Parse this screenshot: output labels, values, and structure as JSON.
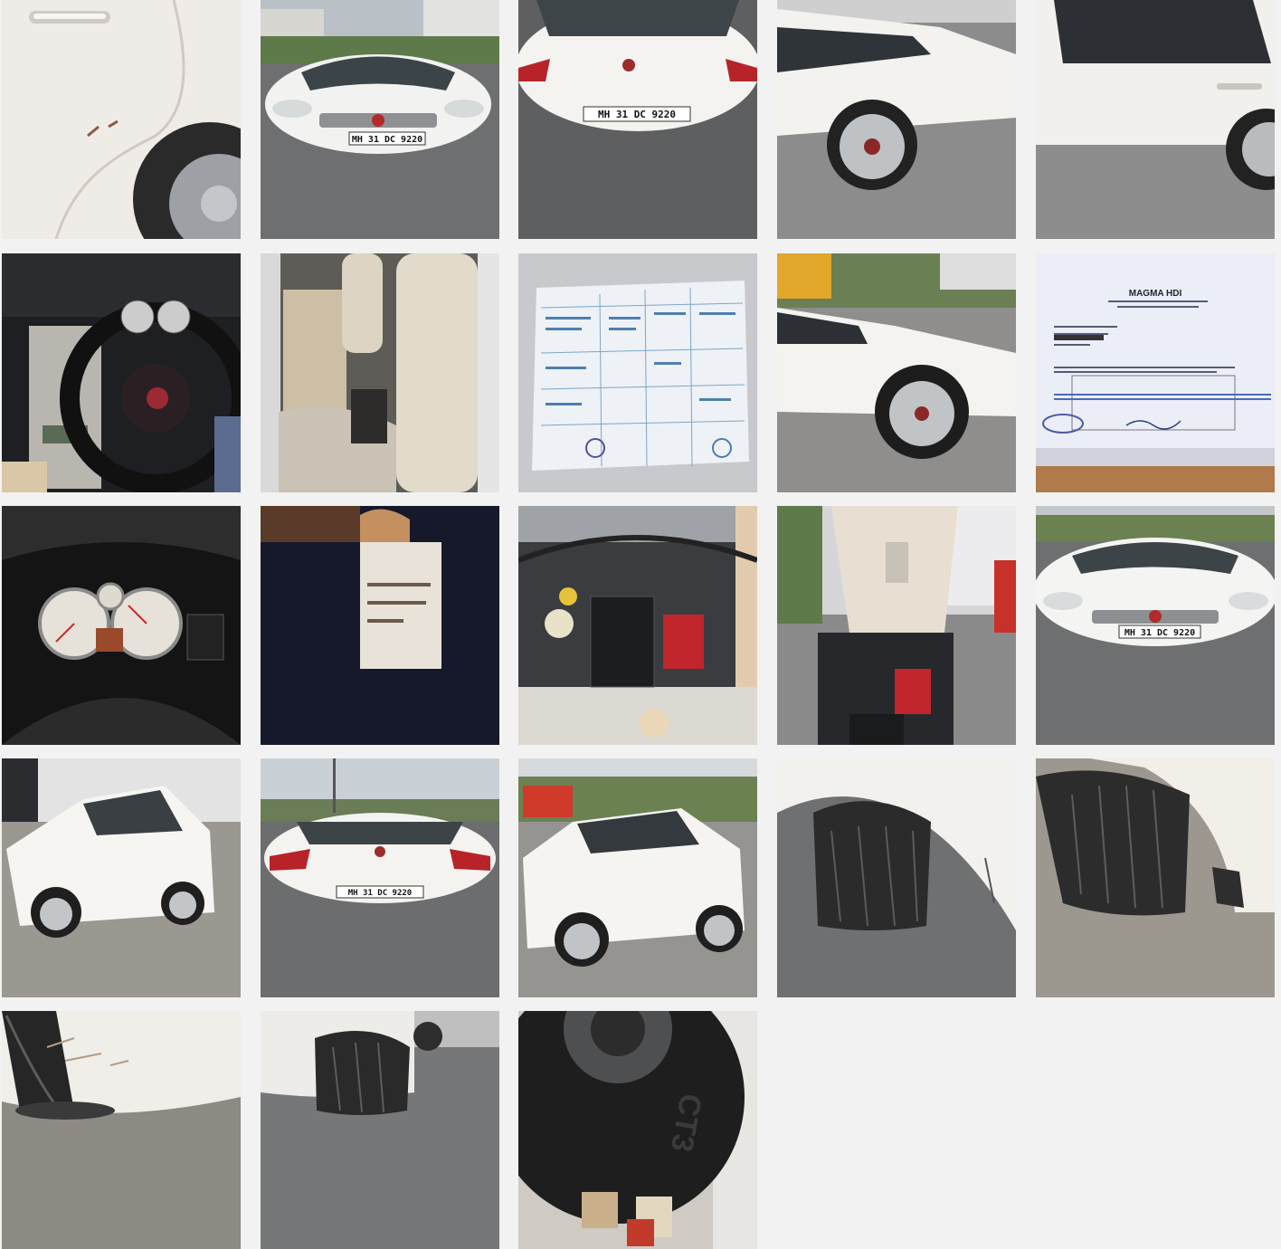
{
  "gallery": {
    "photos": [
      {
        "name": "rear-door-scratch",
        "colors": {
          "bg": "#e8e6e0",
          "accent": "#2a2a2a"
        }
      },
      {
        "name": "front-view",
        "plate": "MH 31 DC 9220"
      },
      {
        "name": "rear-view",
        "plate": "MH 31 DC 9220"
      },
      {
        "name": "right-side-rear"
      },
      {
        "name": "right-side-doors"
      },
      {
        "name": "dashboard-steering"
      },
      {
        "name": "rear-seats"
      },
      {
        "name": "registration-document"
      },
      {
        "name": "left-front-side"
      },
      {
        "name": "insurance-document",
        "header": "MAGMA HDI"
      },
      {
        "name": "instrument-cluster"
      },
      {
        "name": "chassis-number"
      },
      {
        "name": "engine-bay"
      },
      {
        "name": "hood-open"
      },
      {
        "name": "front-view-2",
        "plate": "MH 31 DC 9220"
      },
      {
        "name": "left-front-quarter"
      },
      {
        "name": "rear-view-2",
        "plate": "MH 31 DC 9220"
      },
      {
        "name": "left-rear-quarter"
      },
      {
        "name": "front-tyre-closeup"
      },
      {
        "name": "rear-tyre-closeup"
      },
      {
        "name": "bumper-scratch"
      },
      {
        "name": "rear-tyre-ground"
      },
      {
        "name": "spare-tyre",
        "tyre_text": "CT3"
      }
    ]
  }
}
